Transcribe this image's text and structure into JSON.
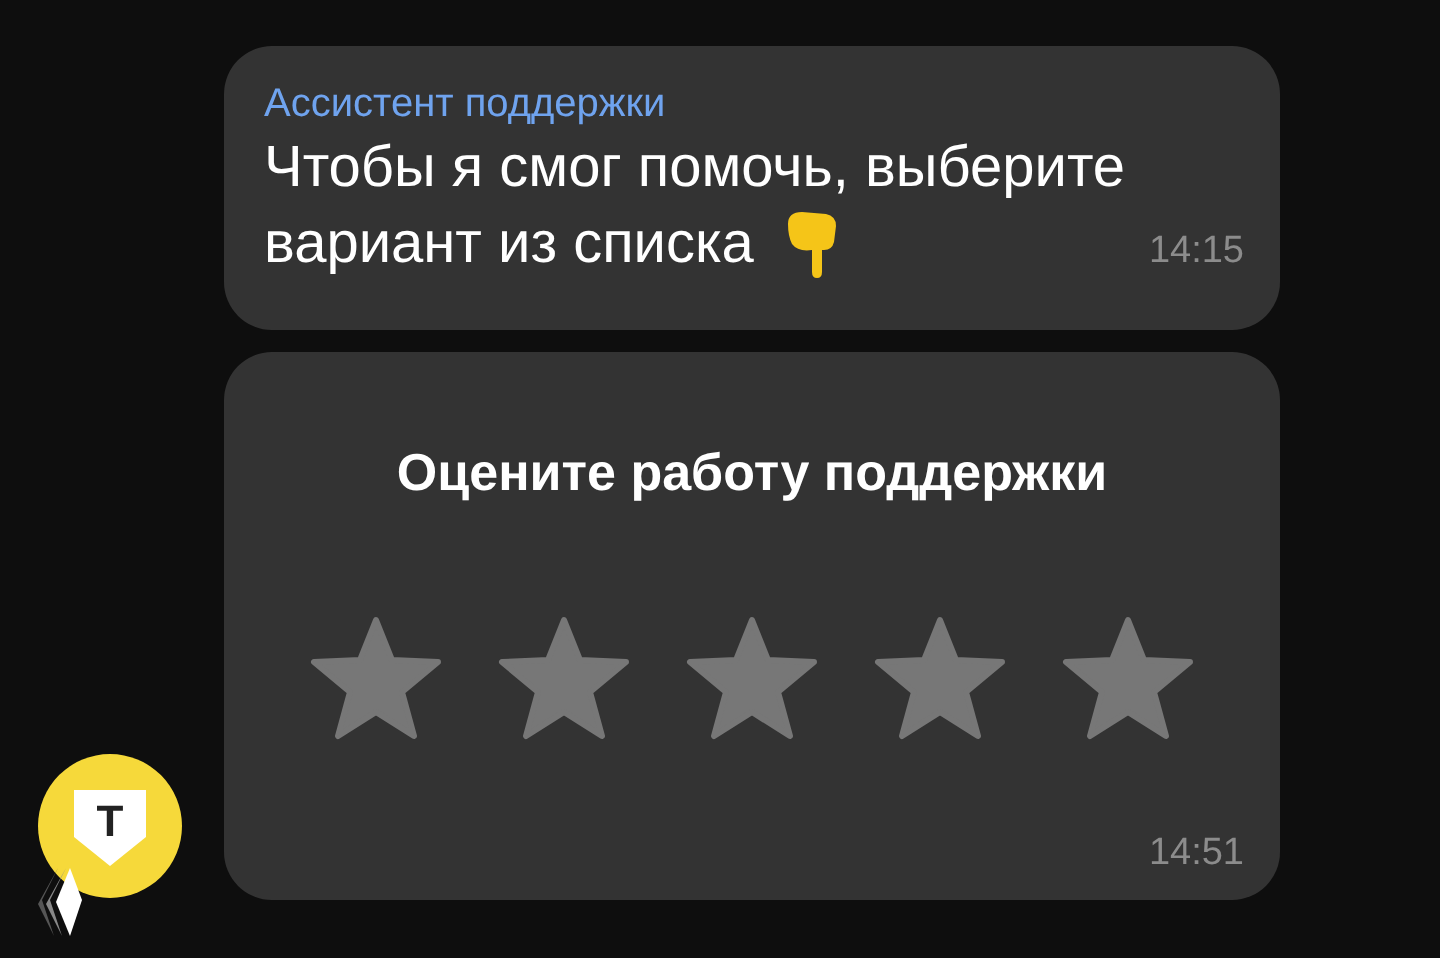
{
  "messages": [
    {
      "kind": "text",
      "sender": "Ассистент поддержки",
      "lines": [
        "Чтобы я смог помочь, выберите",
        "вариант из списка"
      ],
      "time": "14:15"
    },
    {
      "kind": "rating",
      "title": "Оцените работу поддержки",
      "stars": 0,
      "time": "14:51"
    }
  ],
  "avatar": {
    "letter": "Т"
  }
}
